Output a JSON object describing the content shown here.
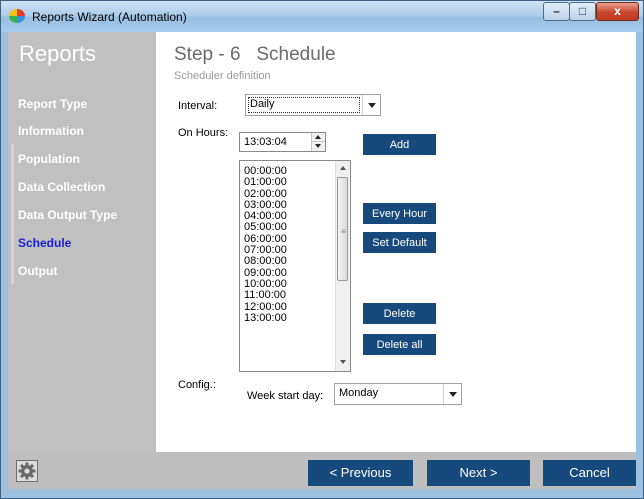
{
  "window": {
    "title": "Reports Wizard (Automation)",
    "app_icon": "rainbow-pie-icon",
    "controls": {
      "minimize": "–",
      "maximize": "□",
      "close": "x"
    }
  },
  "sidebar": {
    "title": "Reports",
    "items": [
      {
        "label": "Report Type",
        "active": false
      },
      {
        "label": "Information",
        "active": false
      },
      {
        "label": "Population",
        "active": false
      },
      {
        "label": "Data Collection",
        "active": false
      },
      {
        "label": "Data Output Type",
        "active": false
      },
      {
        "label": "Schedule",
        "active": true
      },
      {
        "label": "Output",
        "active": false
      }
    ]
  },
  "main": {
    "title": "Step - 6   Schedule",
    "subtitle": "Scheduler definition",
    "interval": {
      "label": "Interval:",
      "value": "Daily"
    },
    "on_hours": {
      "label": "On Hours:",
      "time_value": "13:03:04",
      "hours": [
        "00:00:00",
        "01:00:00",
        "02:00:00",
        "03:00:00",
        "04:00:00",
        "05:00:00",
        "06:00:00",
        "07:00:00",
        "08:00:00",
        "09:00:00",
        "10:00:00",
        "11:00:00",
        "12:00:00",
        "13:00:00"
      ]
    },
    "buttons": {
      "add": "Add",
      "every_hour": "Every Hour",
      "set_default": "Set Default",
      "delete": "Delete",
      "delete_all": "Delete all"
    },
    "config": {
      "label": "Config.:",
      "week_start_label": "Week start day:",
      "week_start_value": "Monday"
    }
  },
  "footer": {
    "settings_icon": "gear-icon",
    "previous": "< Previous",
    "next": "Next >",
    "cancel": "Cancel"
  },
  "colors": {
    "accent": "#174a7c",
    "sidebar_bg": "#c0c0c0",
    "active_nav": "#1a22d6"
  }
}
